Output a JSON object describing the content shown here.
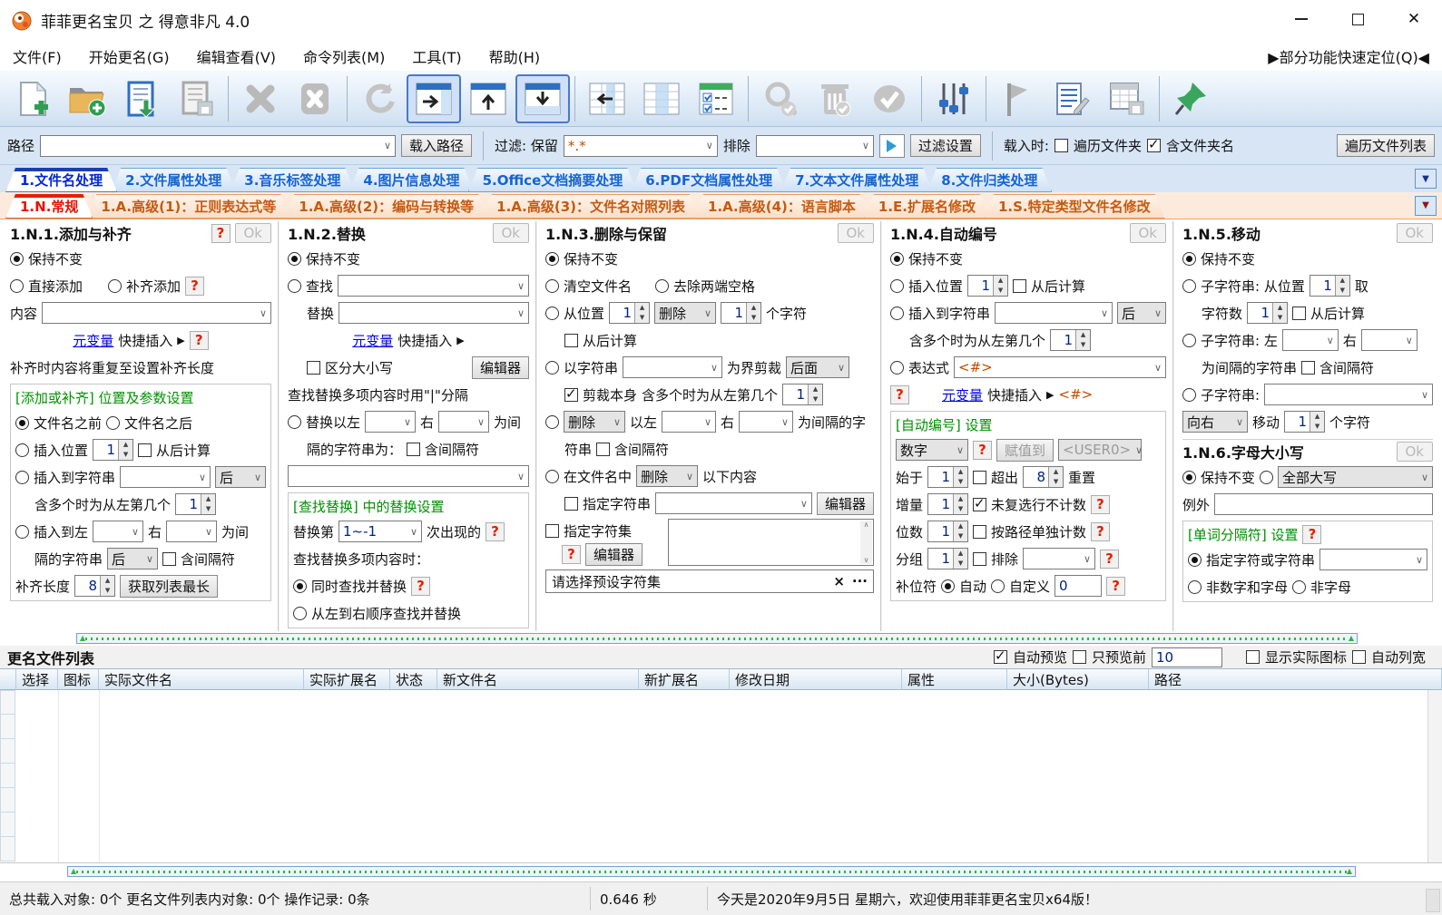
{
  "ui": {
    "help": "?",
    "ok": "Ok",
    "arrow": "▶"
  },
  "window": {
    "title": "菲菲更名宝贝 之 得意非凡 4.0"
  },
  "menu": {
    "items": [
      "文件(F)",
      "开始更名(G)",
      "编辑查看(V)",
      "命令列表(M)",
      "工具(T)",
      "帮助(H)"
    ],
    "quick_locate": "▶部分功能快速定位(Q)◀"
  },
  "toolbar": {
    "icons": [
      "new-file",
      "open-folder-add",
      "load-list",
      "save-list",
      "delete",
      "delete-all",
      "refresh",
      "pane-right",
      "pane-up",
      "pane-down",
      "grid-move-left",
      "grid-columns",
      "check-list",
      "search-check",
      "trash-check",
      "check-all",
      "filter-sliders",
      "flag",
      "edit-list",
      "table-save",
      "pin"
    ]
  },
  "pathbar": {
    "path_label": "路径",
    "load_path": "载入路径",
    "filter_label": "过滤: 保留",
    "filter_value": "*.*",
    "exclude_label": "排除",
    "filter_settings": "过滤设置",
    "load_when": "载入时:",
    "traverse_folders": "遍历文件夹",
    "include_folder_names": "含文件夹名",
    "traverse_file_list": "遍历文件列表"
  },
  "tabs_main": {
    "items": [
      "1.文件名处理",
      "2.文件属性处理",
      "3.音乐标签处理",
      "4.图片信息处理",
      "5.Office文档摘要处理",
      "6.PDF文档属性处理",
      "7.文本文件属性处理",
      "8.文件归类处理"
    ]
  },
  "tabs_sub": {
    "items": [
      "1.N.常规",
      "1.A.高级(1)：正则表达式等",
      "1.A.高级(2)：编码与转换等",
      "1.A.高级(3)：文件名对照列表",
      "1.A.高级(4)：语言脚本",
      "1.E.扩展名修改",
      "1.S.特定类型文件名修改"
    ]
  },
  "panels": {
    "add": {
      "title": "1.N.1.添加与补齐",
      "keep": "保持不变",
      "direct": "直接添加",
      "pad": "补齐添加",
      "content": "内容",
      "metavar": "元变量",
      "quick": "快捷插入",
      "note": "补齐时内容将重复至设置补齐长度",
      "grp": "[添加或补齐] 位置及参数设置",
      "before": "文件名之前",
      "after": "文件名之后",
      "ins_pos": "插入位置",
      "ins_pos_val": "1",
      "from_back": "从后计算",
      "ins_str": "插入到字符串",
      "pos_opt": "后",
      "multi": "含多个时为从左第几个",
      "multi_val": "1",
      "ins_lr": "插入到左",
      "right": "右",
      "wei": "为间",
      "sep": "隔的字符串",
      "sep_opt": "后",
      "inc_sep": "含间隔符",
      "pad_len": "补齐长度",
      "pad_val": "8",
      "get_long": "获取列表最长"
    },
    "rep": {
      "title": "1.N.2.替换",
      "keep": "保持不变",
      "find": "查找",
      "rep": "替换",
      "metavar": "元变量",
      "quick": "快捷插入",
      "case": "区分大小写",
      "editor": "编辑器",
      "note": "查找替换多项内容时用\"|\"分隔",
      "rep_lr": "替换以左",
      "right": "右",
      "wei": "为间",
      "sep": "隔的字符串为：",
      "inc_sep": "含间隔符",
      "grp": "[查找替换] 中的替换设置",
      "nth": "替换第",
      "nth_val": "1~-1",
      "occur": "次出现的",
      "multi_when": "查找替换多项内容时：",
      "simul": "同时查找并替换",
      "seq": "从左到右顺序查找并替换"
    },
    "del": {
      "title": "1.N.3.删除与保留",
      "keep": "保持不变",
      "clear": "清空文件名",
      "trim": "去除两端空格",
      "from_pos": "从位置",
      "pos_val": "1",
      "act": "删除",
      "cnt_val": "1",
      "chars": "个字符",
      "from_back": "从后计算",
      "by_str": "以字符串",
      "bound": "为界剪裁",
      "rear": "后面",
      "cut_self": "剪裁本身",
      "multi": "含多个时为从左第几个",
      "multi_val": "1",
      "act2": "删除",
      "lr": "以左",
      "right": "右",
      "sep1": "为间隔的字",
      "sep2": "符串",
      "inc_sep": "含间隔符",
      "in_name": "在文件名中",
      "act3": "删除",
      "following": "以下内容",
      "spec_str": "指定字符串",
      "editor": "编辑器",
      "spec_set": "指定字符集",
      "editor2": "编辑器",
      "preset": "请选择预设字符集",
      "clear_x": "×",
      "more": "···"
    },
    "num": {
      "title": "1.N.4.自动编号",
      "keep": "保持不变",
      "ins_pos": "插入位置",
      "pos_val": "1",
      "from_back": "从后计算",
      "ins_str": "插入到字符串",
      "pos_opt": "后",
      "multi": "含多个时为从左第几个",
      "multi_val": "1",
      "expr": "表达式",
      "expr_val": "<#>",
      "metavar": "元变量",
      "quick": "快捷插入",
      "tag": "<#>",
      "grp": "[自动编号] 设置",
      "type": "数字",
      "assign": "赋值到",
      "target": "<USER0>",
      "start": "始于",
      "start_val": "1",
      "exceed": "超出",
      "exceed_val": "8",
      "reset": "重置",
      "inc": "增量",
      "inc_val": "1",
      "uncount": "未复选行不计数",
      "digits": "位数",
      "dig_val": "1",
      "per_path": "按路径单独计数",
      "group": "分组",
      "grp_val": "1",
      "exclude": "排除",
      "pad": "补位符",
      "auto": "自动",
      "custom": "自定义",
      "pad_val": "0"
    },
    "move": {
      "title": "1.N.5.移动",
      "keep": "保持不变",
      "sub1": "子字符串: 从位置",
      "p_val": "1",
      "take": "取",
      "chars": "字符数",
      "c_val": "1",
      "from_back": "从后计算",
      "sub2": "子字符串: 左",
      "right": "右",
      "sep": "为间隔的字符串",
      "inc_sep": "含间隔符",
      "sub3": "子字符串:",
      "dir": "向右",
      "move": "移动",
      "m_val": "1",
      "chars2": "个字符"
    },
    "case": {
      "title": "1.N.6.字母大小写",
      "keep": "保持不变",
      "opt": "全部大写",
      "except": "例外",
      "grp": "[单词分隔符] 设置",
      "spec": "指定字符或字符串",
      "non_an": "非数字和字母",
      "non_a": "非字母"
    }
  },
  "list": {
    "title": "更名文件列表",
    "auto_prev": "自动预览",
    "prev_first": "只预览前",
    "prev_n": "10",
    "show_icon": "显示实际图标",
    "auto_w": "自动列宽",
    "columns": [
      "选择",
      "图标",
      "实际文件名",
      "实际扩展名",
      "状态",
      "新文件名",
      "新扩展名",
      "修改日期",
      "属性",
      "大小(Bytes)",
      "路径"
    ]
  },
  "status": {
    "left": "总共载入对象: 0个  更名文件列表内对象: 0个  操作记录: 0条",
    "time": "0.646 秒",
    "right": "今天是2020年9月5日 星期六，欢迎使用菲菲更名宝贝x64版！"
  }
}
